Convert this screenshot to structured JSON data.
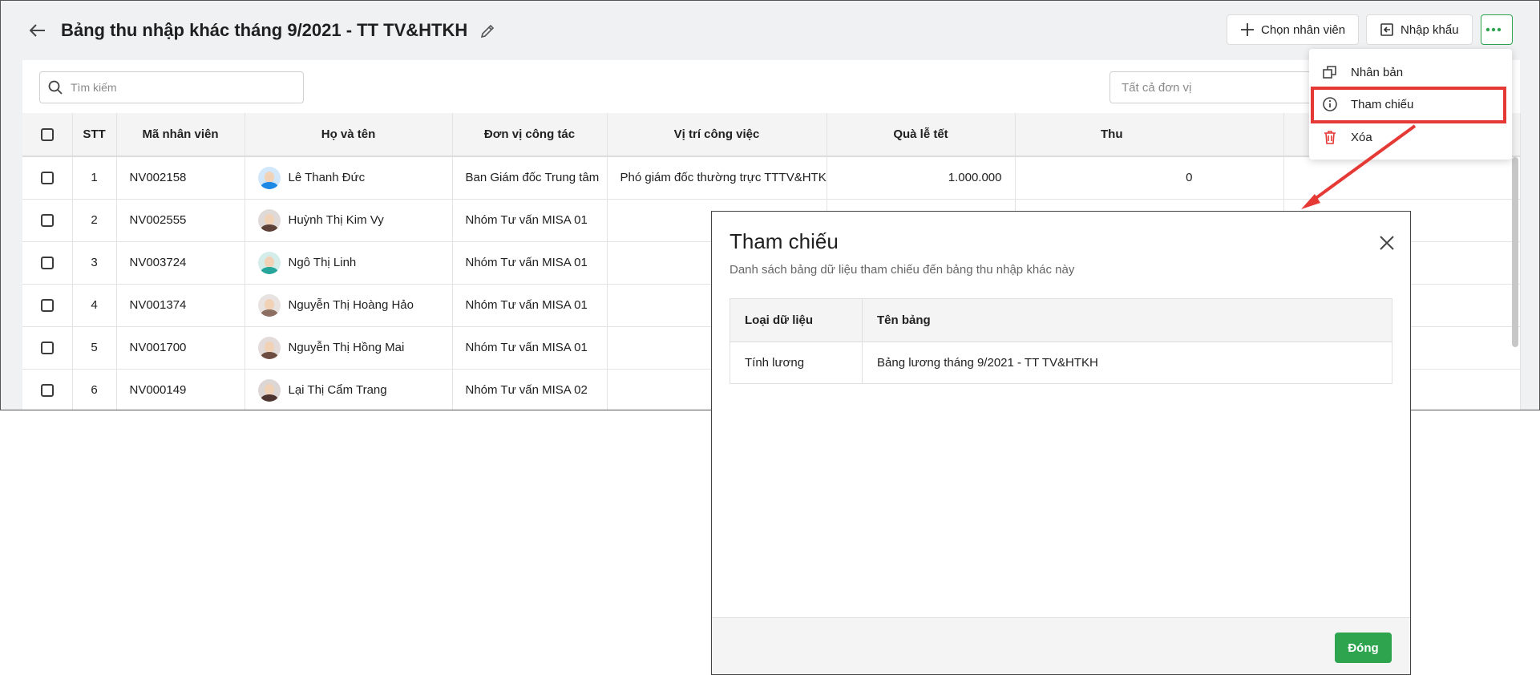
{
  "header": {
    "title": "Bảng thu nhập khác tháng 9/2021 - TT TV&HTKH",
    "choose_employee_label": "Chọn nhân viên",
    "import_label": "Nhập khẩu"
  },
  "toolbar": {
    "search_placeholder": "Tìm kiếm",
    "unit_filter": "Tất cả đơn vị"
  },
  "table": {
    "columns": [
      "STT",
      "Mã nhân viên",
      "Họ và tên",
      "Đơn vị công tác",
      "Vị trí công việc",
      "Quà lễ tết",
      "Thu"
    ],
    "rows": [
      {
        "stt": "1",
        "code": "NV002158",
        "name": "Lê Thanh Đức",
        "unit": "Ban Giám đốc Trung tâm",
        "position": "Phó giám đốc thường trực TTTV&HTKH",
        "gift": "1.000.000",
        "other": "0"
      },
      {
        "stt": "2",
        "code": "NV002555",
        "name": "Huỳnh Thị Kim Vy",
        "unit": "Nhóm Tư vấn MISA 01",
        "position": "",
        "gift": "",
        "other": ""
      },
      {
        "stt": "3",
        "code": "NV003724",
        "name": "Ngô Thị Linh",
        "unit": "Nhóm Tư vấn MISA 01",
        "position": "",
        "gift": "",
        "other": ""
      },
      {
        "stt": "4",
        "code": "NV001374",
        "name": "Nguyễn Thị Hoàng Hảo",
        "unit": "Nhóm Tư vấn MISA 01",
        "position": "",
        "gift": "",
        "other": ""
      },
      {
        "stt": "5",
        "code": "NV001700",
        "name": "Nguyễn Thị Hồng Mai",
        "unit": "Nhóm Tư vấn MISA 01",
        "position": "",
        "gift": "",
        "other": ""
      },
      {
        "stt": "6",
        "code": "NV000149",
        "name": "Lại Thị Cẩm Trang",
        "unit": "Nhóm Tư vấn MISA 02",
        "position": "",
        "gift": "",
        "other": ""
      }
    ]
  },
  "menu": {
    "items": [
      {
        "label": "Nhân bản",
        "icon": "duplicate-icon"
      },
      {
        "label": "Tham chiếu",
        "icon": "info-icon"
      },
      {
        "label": "Xóa",
        "icon": "trash-icon"
      }
    ]
  },
  "modal": {
    "title": "Tham chiếu",
    "subtitle": "Danh sách bảng dữ liệu tham chiếu đến bảng thu nhập khác này",
    "columns": [
      "Loại dữ liệu",
      "Tên bảng"
    ],
    "rows": [
      {
        "type": "Tính lương",
        "name": "Bảng lương tháng 9/2021 - TT TV&HTKH"
      }
    ],
    "close_label": "Đóng"
  },
  "colors": {
    "accent": "#2ea44f",
    "highlight": "#e53935",
    "avatar_colors": [
      "#1e88e5",
      "#5d4037",
      "#26a69a",
      "#8d6e63",
      "#6d4c41",
      "#4e342e"
    ]
  }
}
